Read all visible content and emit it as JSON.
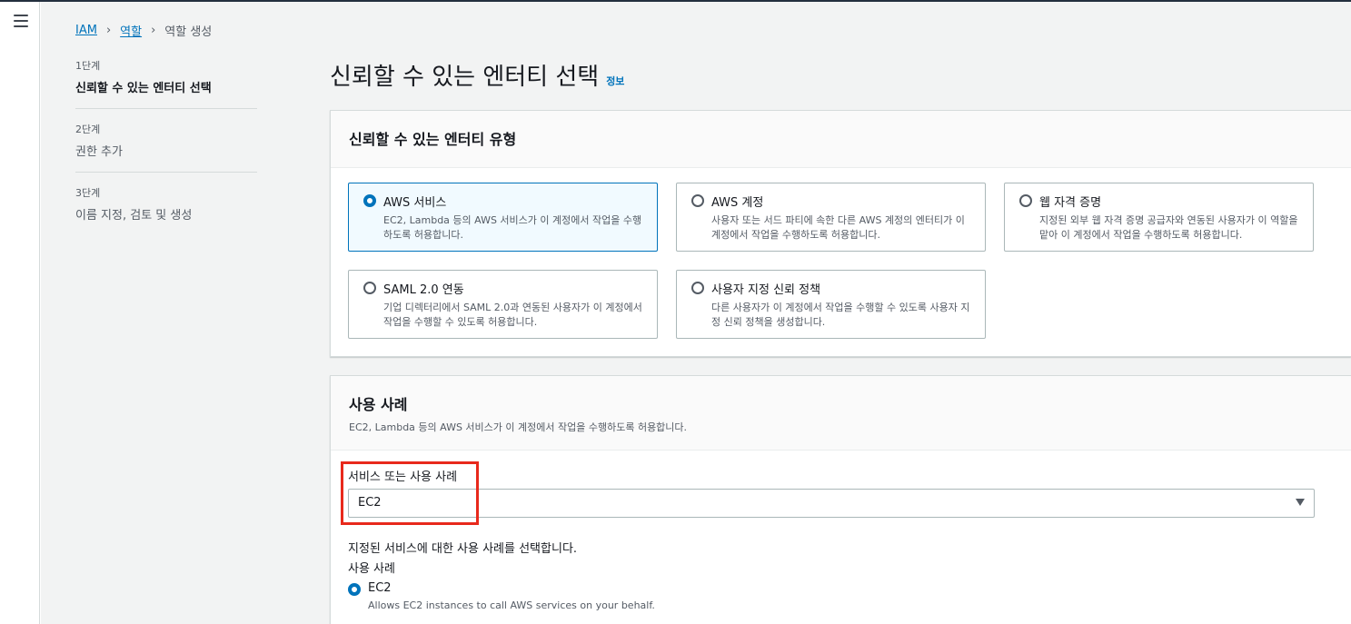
{
  "breadcrumb": {
    "items": [
      "IAM",
      "역할"
    ],
    "current": "역할 생성"
  },
  "steps": [
    {
      "num": "1단계",
      "title": "신뢰할 수 있는 엔터티 선택"
    },
    {
      "num": "2단계",
      "title": "권한 추가"
    },
    {
      "num": "3단계",
      "title": "이름 지정, 검토 및 생성"
    }
  ],
  "page": {
    "title": "신뢰할 수 있는 엔터티 선택",
    "info": "정보"
  },
  "entity_panel": {
    "title": "신뢰할 수 있는 엔터티 유형",
    "options": [
      {
        "title": "AWS 서비스",
        "desc": "EC2, Lambda 등의 AWS 서비스가 이 계정에서 작업을 수행하도록 허용합니다.",
        "selected": true
      },
      {
        "title": "AWS 계정",
        "desc": "사용자 또는 서드 파티에 속한 다른 AWS 계정의 엔터티가 이 계정에서 작업을 수행하도록 허용합니다.",
        "selected": false
      },
      {
        "title": "웹 자격 증명",
        "desc": "지정된 외부 웹 자격 증명 공급자와 연동된 사용자가 이 역할을 맡아 이 계정에서 작업을 수행하도록 허용합니다.",
        "selected": false
      },
      {
        "title": "SAML 2.0 연동",
        "desc": "기업 디렉터리에서 SAML 2.0과 연동된 사용자가 이 계정에서 작업을 수행할 수 있도록 허용합니다.",
        "selected": false
      },
      {
        "title": "사용자 지정 신뢰 정책",
        "desc": "다른 사용자가 이 계정에서 작업을 수행할 수 있도록 사용자 지정 신뢰 정책을 생성합니다.",
        "selected": false
      }
    ]
  },
  "usecase_panel": {
    "title": "사용 사례",
    "desc": "EC2, Lambda 등의 AWS 서비스가 이 계정에서 작업을 수행하도록 허용합니다.",
    "field_label": "서비스 또는 사용 사례",
    "selected_value": "EC2",
    "helper": "지정된 서비스에 대한 사용 사례를 선택합니다.",
    "usecase_label": "사용 사례",
    "usecase_option": {
      "title": "EC2",
      "desc": "Allows EC2 instances to call AWS services on your behalf."
    }
  },
  "colors": {
    "accent": "#0073bb",
    "highlight": "#e8291c",
    "background": "#f2f3f3"
  }
}
